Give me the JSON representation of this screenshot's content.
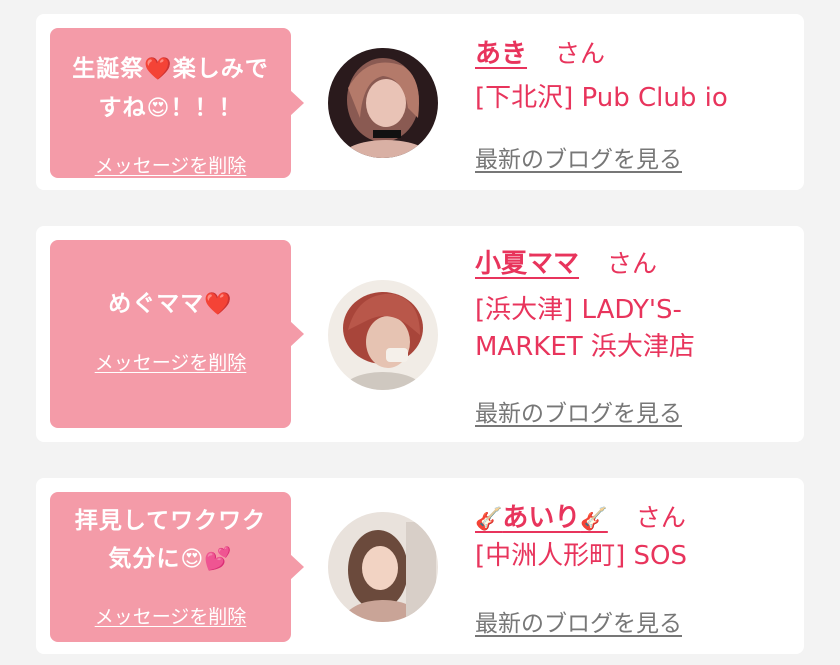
{
  "cards": [
    {
      "message_line1": "生誕祭",
      "message_emoji1": "❤️",
      "message_line1b": "楽しみで",
      "message_line2": "すね",
      "message_emoji2": "😍",
      "message_line2b": "！！！",
      "delete_label": "メッセージを削除",
      "name": "あき",
      "honorific": "さん",
      "shop_line1": "[下北沢] Pub Club io",
      "blog_label": "最新のブログを見る",
      "avatar_icon": "woman-portrait-dark-icon"
    },
    {
      "message_line1": "めぐママ",
      "message_emoji1": "❤️",
      "delete_label": "メッセージを削除",
      "name": "小夏ママ",
      "honorific": "さん",
      "shop_line1": "[浜大津] LADY'S-",
      "shop_line2": "MARKET 浜大津店",
      "blog_label": "最新のブログを見る",
      "avatar_icon": "woman-short-red-hair-icon"
    },
    {
      "message_line1": "拝見してワクワク",
      "message_line2": "気分に",
      "message_emoji2": "😍💕",
      "delete_label": "メッセージを削除",
      "name_prefix_icon": "🎸",
      "name": "あいり",
      "name_suffix_icon": "🎸",
      "honorific": "さん",
      "shop_line1": "[中洲人形町] SOS",
      "blog_label": "最新のブログを見る",
      "avatar_icon": "woman-light-portrait-icon"
    }
  ],
  "colors": {
    "background": "#f3f3f3",
    "bubble": "#f49ba8",
    "accent": "#e8345c",
    "link_gray": "#777777"
  }
}
